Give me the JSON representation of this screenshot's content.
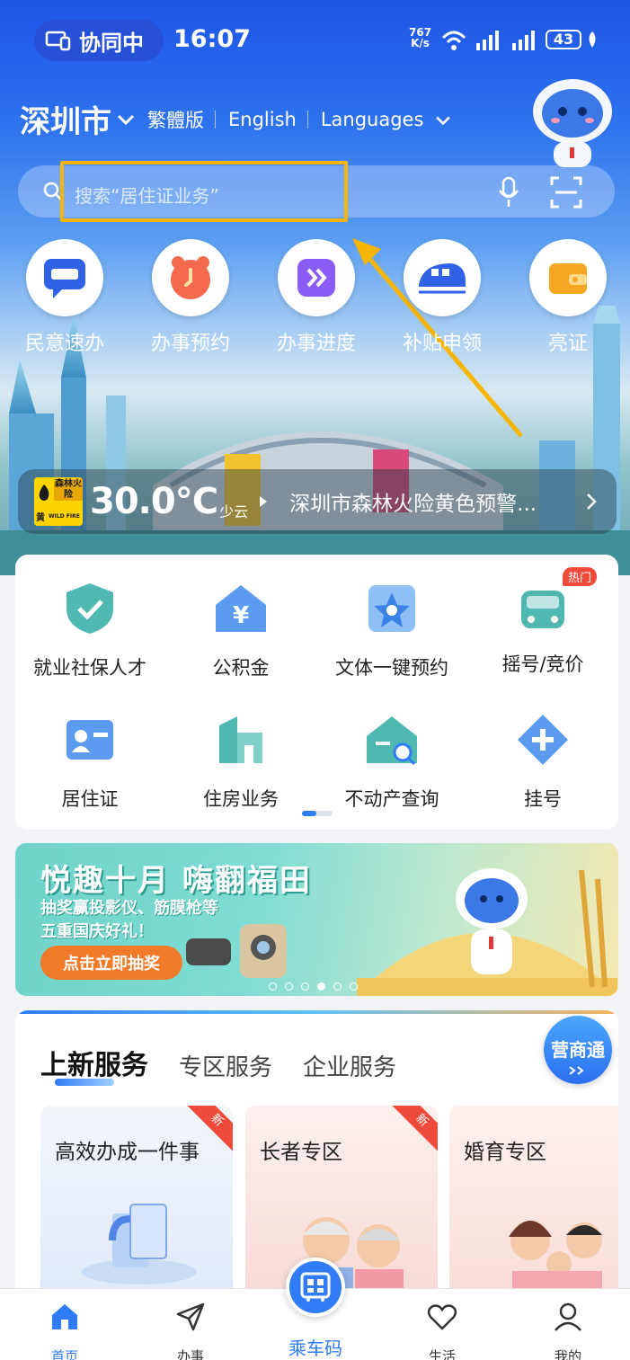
{
  "status_bar": {
    "collab_label": "协同中",
    "time": "16:07",
    "net_speed_value": "767",
    "net_speed_unit": "K/s",
    "battery": "43"
  },
  "header": {
    "city": "深圳市",
    "lang_traditional": "繁體版",
    "lang_english": "English",
    "lang_more": "Languages"
  },
  "search": {
    "placeholder": "搜索“居住证业务”"
  },
  "quick_actions": [
    {
      "label": "民意速办",
      "icon": "feedback-icon"
    },
    {
      "label": "办事预约",
      "icon": "clock-icon"
    },
    {
      "label": "办事进度",
      "icon": "progress-icon"
    },
    {
      "label": "补贴申领",
      "icon": "train-icon"
    },
    {
      "label": "亮证",
      "icon": "wallet-icon"
    }
  ],
  "weather": {
    "badge_text": "森林火险",
    "badge_level": "黄",
    "badge_sub": "WILD FIRE",
    "temperature": "30.0℃",
    "condition": "少云",
    "alert": "深圳市森林火险黄色预警..."
  },
  "services_grid": [
    {
      "label": "就业社保人才",
      "icon": "shield-check-icon"
    },
    {
      "label": "公积金",
      "icon": "yuan-house-icon"
    },
    {
      "label": "文体一键预约",
      "icon": "star-icon"
    },
    {
      "label": "摇号/竞价",
      "icon": "car-icon",
      "badge": "热门"
    },
    {
      "label": "居住证",
      "icon": "id-card-icon"
    },
    {
      "label": "住房业务",
      "icon": "building-icon"
    },
    {
      "label": "不动产查询",
      "icon": "house-search-icon"
    },
    {
      "label": "挂号",
      "icon": "medical-plus-icon"
    }
  ],
  "banner": {
    "title": "悦趣十月 嗨翻福田",
    "line1": "抽奖赢投影仪、筋膜枪等",
    "line2": "五重国庆好礼！",
    "button": "点击立即抽奖",
    "slide_count": 6,
    "active_slide": 4
  },
  "service_section": {
    "tabs": [
      "上新服务",
      "专区服务",
      "企业服务"
    ],
    "active_tab": 0,
    "float_button": "营商通",
    "cards": [
      {
        "title": "高效办成一件事",
        "badge": "新"
      },
      {
        "title": "长者专区",
        "badge": "新"
      },
      {
        "title": "婚育专区",
        "badge": ""
      }
    ]
  },
  "bottom_nav": [
    {
      "label": "首页",
      "icon": "home-icon",
      "active": true
    },
    {
      "label": "办事",
      "icon": "send-icon",
      "active": false
    },
    {
      "label": "乘车码",
      "icon": "bus-qr-icon",
      "active": false
    },
    {
      "label": "生活",
      "icon": "heart-icon",
      "active": false
    },
    {
      "label": "我的",
      "icon": "user-icon",
      "active": false
    }
  ],
  "colors": {
    "primary": "#2f7cf6",
    "highlight": "#f7b500",
    "hot_badge": "#f04a3a"
  }
}
